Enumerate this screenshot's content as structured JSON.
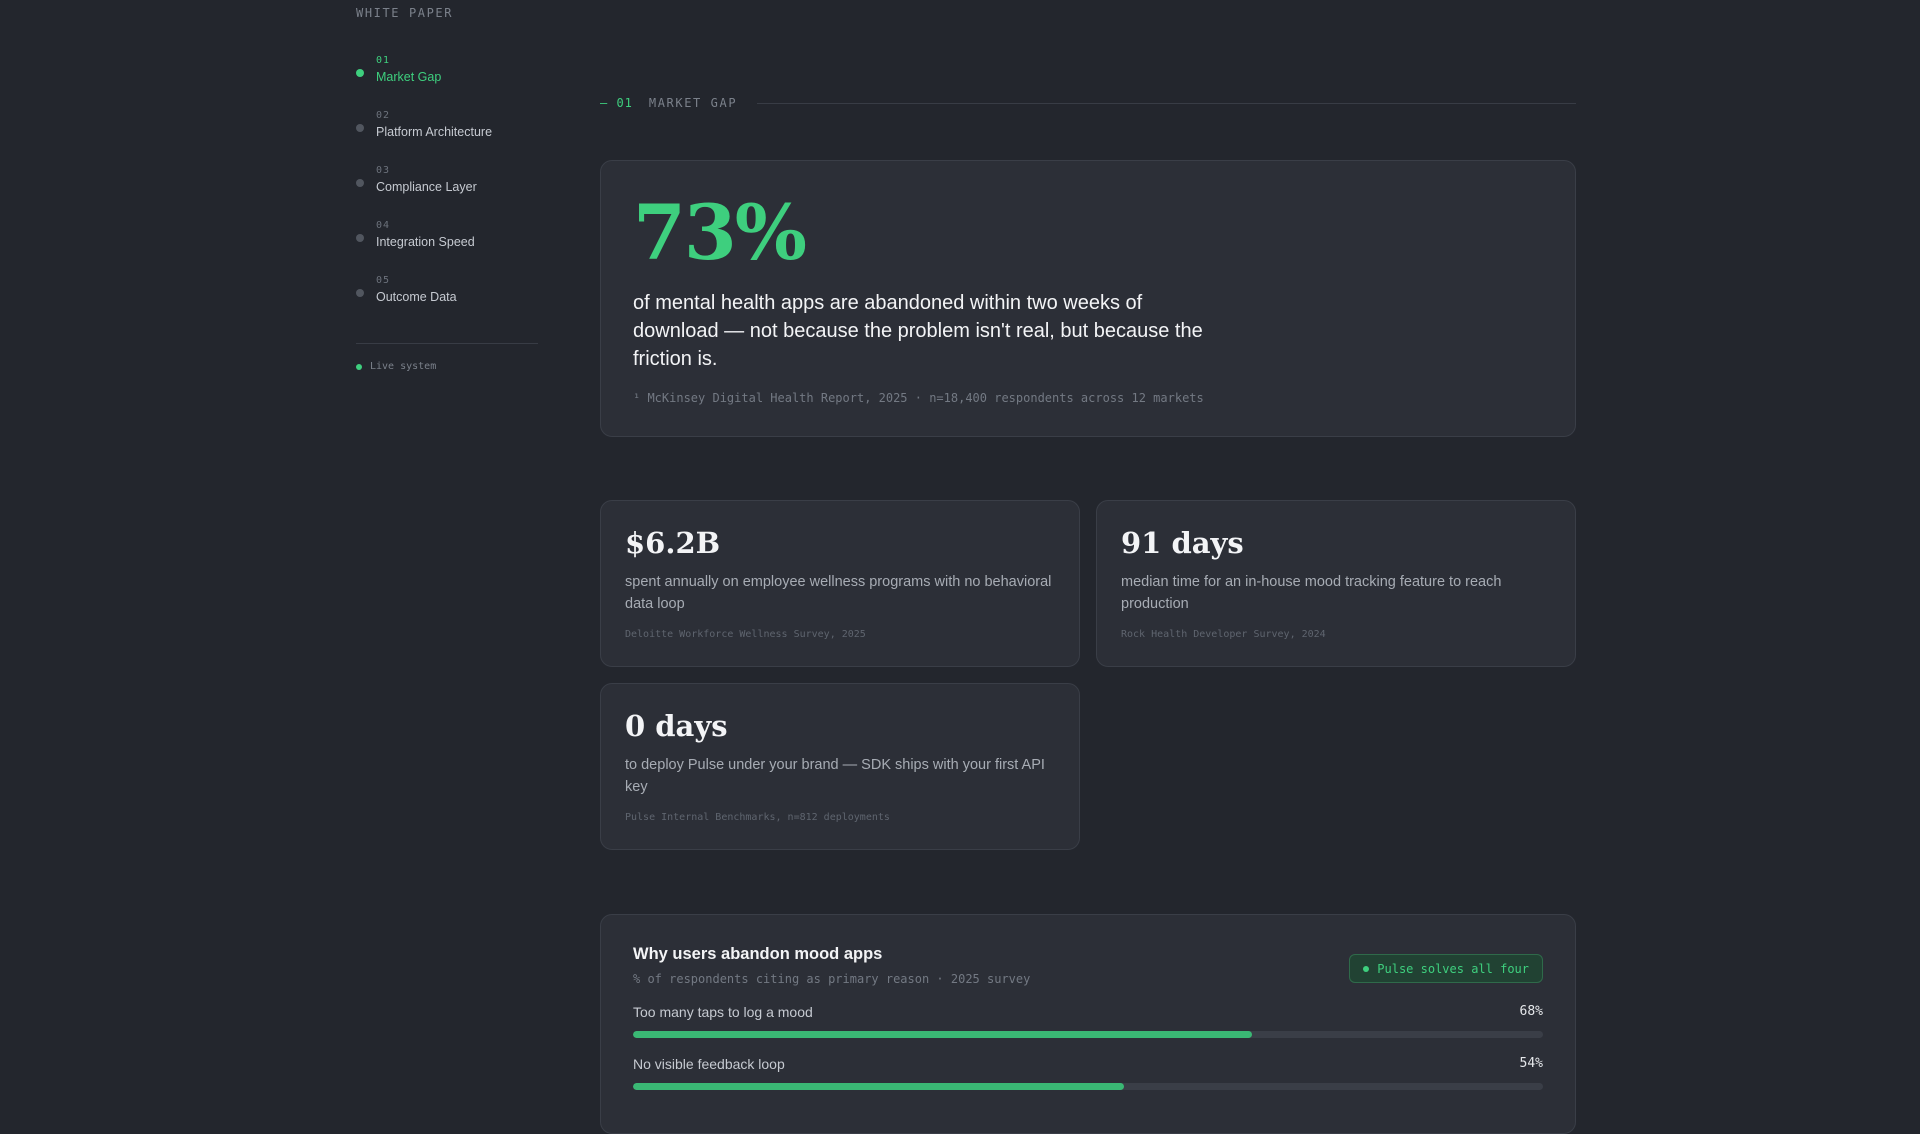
{
  "sidebar": {
    "eyebrow": "WHITE PAPER",
    "items": [
      {
        "num": "01",
        "label": "Market Gap",
        "active": true
      },
      {
        "num": "02",
        "label": "Platform Architecture",
        "active": false
      },
      {
        "num": "03",
        "label": "Compliance Layer",
        "active": false
      },
      {
        "num": "04",
        "label": "Integration Speed",
        "active": false
      },
      {
        "num": "05",
        "label": "Outcome Data",
        "active": false
      }
    ],
    "status": "Live system"
  },
  "section": {
    "num": "— 01",
    "title": "MARKET GAP"
  },
  "hero": {
    "value": "73%",
    "text": "of mental health apps are abandoned within two weeks of download — not because the problem isn't real, but because the friction is.",
    "source": "¹ McKinsey Digital Health Report, 2025 · n=18,400 respondents across 12 markets"
  },
  "stats": [
    {
      "value": "$6.2B",
      "desc": "spent annually on employee wellness programs with no behavioral data loop",
      "source": "Deloitte Workforce Wellness Survey, 2025"
    },
    {
      "value": "91 days",
      "desc": "median time for an in-house mood tracking feature to reach production",
      "source": "Rock Health Developer Survey, 2024"
    },
    {
      "value": "0 days",
      "desc": "to deploy Pulse under your brand — SDK ships with your first API key",
      "source": "Pulse Internal Benchmarks, n=812 deployments"
    }
  ],
  "reasons": {
    "title": "Why users abandon mood apps",
    "subtitle": "% of respondents citing as primary reason · 2025 survey",
    "badge": "Pulse solves all four",
    "bars": [
      {
        "label": "Too many taps to log a mood",
        "value_text": "68%",
        "value": 68
      },
      {
        "label": "No visible feedback loop",
        "value_text": "54%",
        "value": 54
      }
    ]
  },
  "colors": {
    "accent": "#3ecf7e",
    "background": "#23262d",
    "card": "#2c2f37"
  }
}
